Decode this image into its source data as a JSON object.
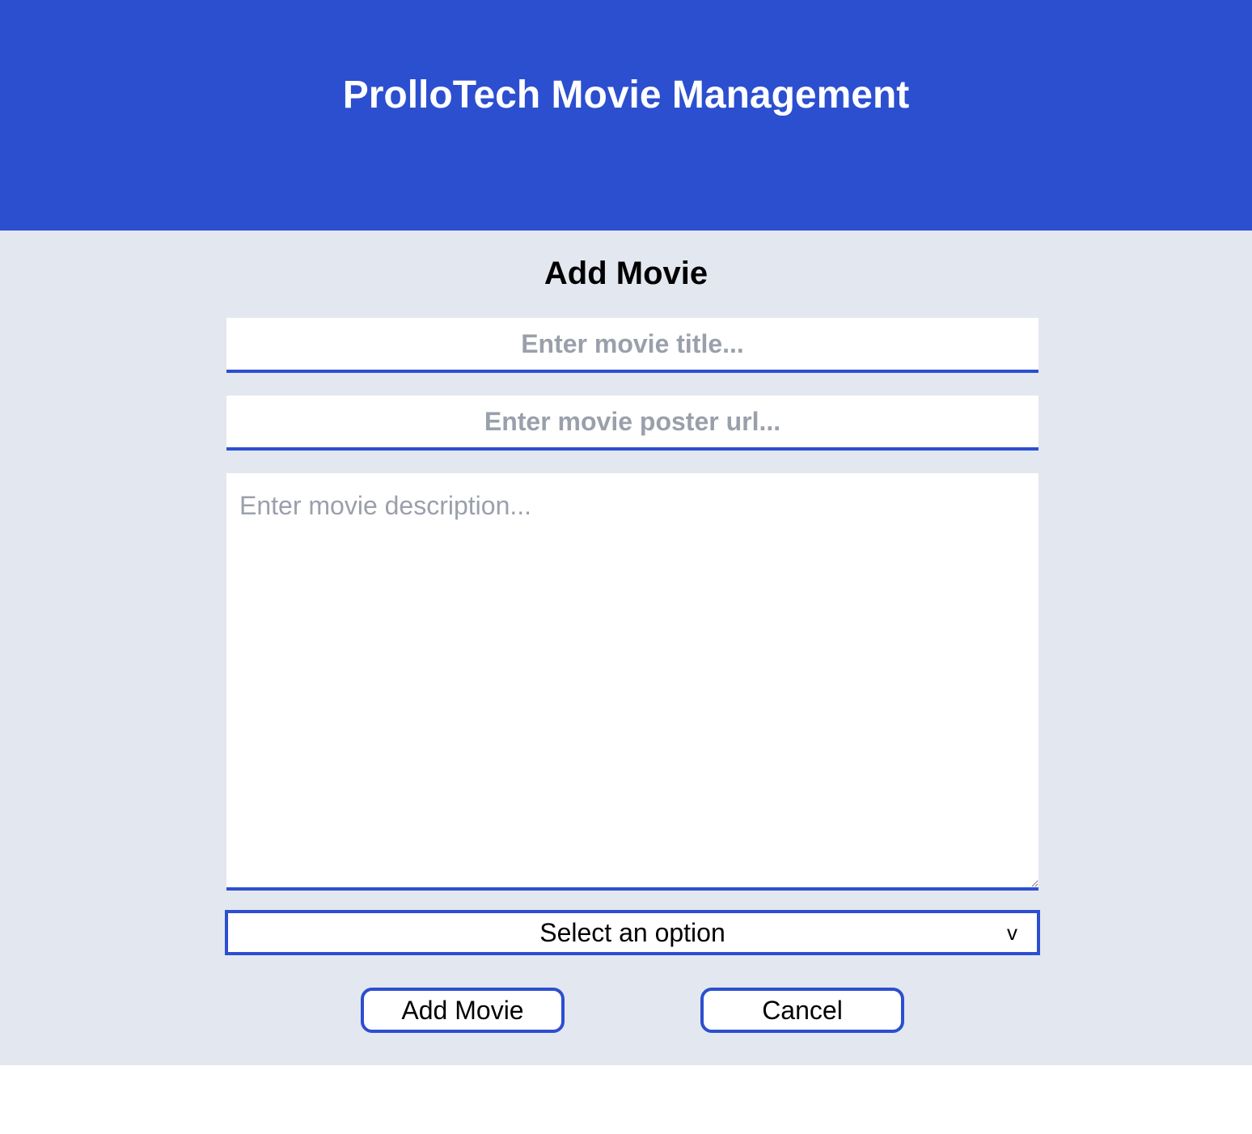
{
  "header": {
    "title": "ProlloTech Movie Management"
  },
  "form": {
    "heading": "Add Movie",
    "title_field": {
      "placeholder": "Enter movie title..."
    },
    "poster_field": {
      "placeholder": "Enter movie poster url..."
    },
    "description_field": {
      "placeholder": "Enter movie description..."
    },
    "category_select": {
      "selected": "Select an option",
      "icon": "chevron-down-icon",
      "glyph": "v"
    },
    "add_button_label": "Add Movie",
    "cancel_button_label": "Cancel"
  },
  "colors": {
    "accent": "#2c4fd0",
    "page_background": "#e3e7ef",
    "placeholder": "#9aa0ab"
  }
}
